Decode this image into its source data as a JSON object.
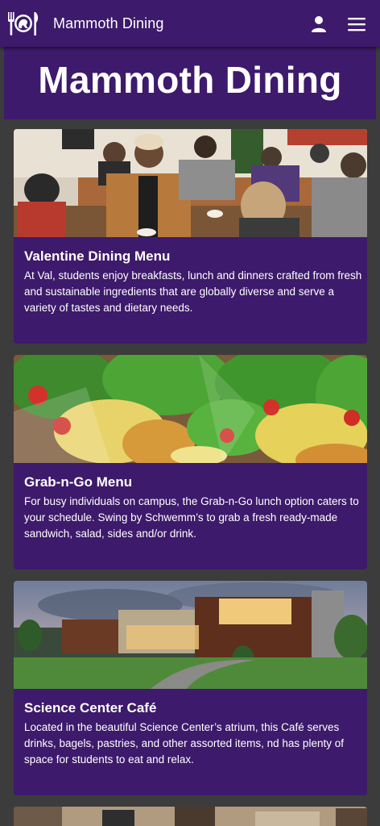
{
  "header": {
    "brand": "Mammoth Dining",
    "logo_icon": "fork-knife-mammoth-logo-icon",
    "user_icon": "user-icon",
    "menu_icon": "hamburger-menu-icon"
  },
  "hero": {
    "title": "Mammoth Dining"
  },
  "cards": [
    {
      "title": "Valentine Dining Menu",
      "body": "At Val, students enjoy breakfasts, lunch and dinners crafted from fresh and sustainable ingredients that are globally diverse and serve a variety of tastes and dietary needs."
    },
    {
      "title": "Grab-n-Go Menu",
      "body": "For busy individuals on campus, the Grab-n-Go lunch option caters to your schedule. Swing by Schwemm’s to grab a fresh ready-made sandwich, salad, sides and/or drink."
    },
    {
      "title": "Science Center Café",
      "body": "Located in the beautiful Science Center’s atrium, this Café serves drinks, bagels, pastries, and other assorted items, nd has plenty of space for students to eat and relax."
    }
  ],
  "colors": {
    "brand_purple": "#3d1a6b",
    "page_background": "#3c3c3c",
    "text": "#ffffff"
  }
}
